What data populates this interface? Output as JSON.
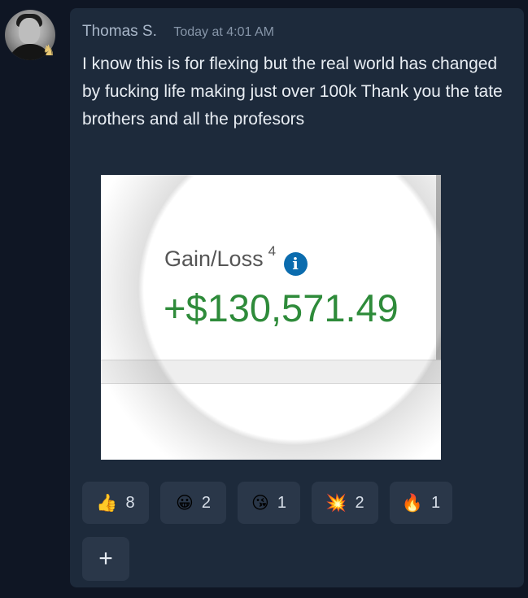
{
  "author": {
    "name": "Thomas S.",
    "timestamp": "Today at 4:01 AM",
    "avatar_icon": "user-avatar-photo",
    "role_badge_icon": "chess-knight-icon",
    "role_badge_glyph": "♞"
  },
  "message": {
    "text": "I know this is for flexing but the real world has changed by fucking life making just over 100k Thank you the tate brothers and all the profesors"
  },
  "attachment": {
    "label": "Gain/Loss",
    "superscript": "4",
    "info_glyph": "i",
    "value": "+$130,571.49",
    "value_color": "#2e8b3a"
  },
  "reactions": [
    {
      "emoji": "👍",
      "icon": "thumbs-up-icon",
      "count": "8"
    },
    {
      "emoji": "😀",
      "icon": "grinning-face-icon",
      "count": "2"
    },
    {
      "emoji": "😘",
      "icon": "kissing-face-icon",
      "count": "1"
    },
    {
      "emoji": "💥",
      "icon": "collision-icon",
      "count": "2"
    },
    {
      "emoji": "🔥",
      "icon": "fire-icon",
      "count": "1"
    }
  ],
  "add_reaction": {
    "label": "+"
  },
  "colors": {
    "background": "#0f1624",
    "card": "#1d2a3b",
    "reaction_chip": "#2a3749"
  }
}
